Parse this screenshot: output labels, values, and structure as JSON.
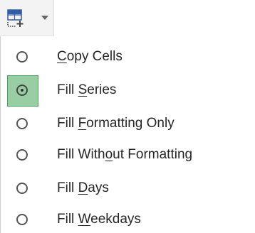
{
  "autofill_options": {
    "button_icon": "autofill-options-icon",
    "arrow_icon": "chevron-down-icon",
    "items": [
      {
        "label_before": "",
        "accel": "C",
        "label_after": "opy Cells",
        "selected": false
      },
      {
        "label_before": "Fill ",
        "accel": "S",
        "label_after": "eries",
        "selected": true
      },
      {
        "label_before": "Fill ",
        "accel": "F",
        "label_after": "ormatting Only",
        "selected": false
      },
      {
        "label_before": "Fill With",
        "accel": "o",
        "label_after": "ut Formatting",
        "selected": false
      },
      {
        "label_before": "Fill ",
        "accel": "D",
        "label_after": "ays",
        "selected": false
      },
      {
        "label_before": "Fill ",
        "accel": "W",
        "label_after": "eekdays",
        "selected": false
      }
    ]
  },
  "colors": {
    "selected_bg": "#99cea5",
    "selected_border": "#4b9d5f",
    "icon_blue": "#2f5da8",
    "text": "#262626"
  }
}
